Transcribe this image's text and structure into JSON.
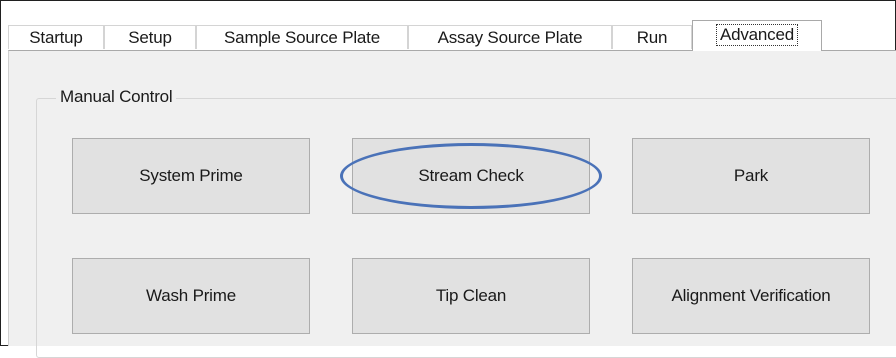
{
  "tabs": [
    {
      "label": "Startup"
    },
    {
      "label": "Setup"
    },
    {
      "label": "Sample Source Plate"
    },
    {
      "label": "Assay Source Plate"
    },
    {
      "label": "Run"
    },
    {
      "label": "Advanced"
    }
  ],
  "group": {
    "title": "Manual Control"
  },
  "buttons": {
    "system_prime": "System Prime",
    "stream_check": "Stream Check",
    "park": "Park",
    "wash_prime": "Wash Prime",
    "tip_clean": "Tip Clean",
    "alignment_verification": "Alignment Verification"
  },
  "annotation": {
    "highlight_color": "#4a72b8"
  }
}
